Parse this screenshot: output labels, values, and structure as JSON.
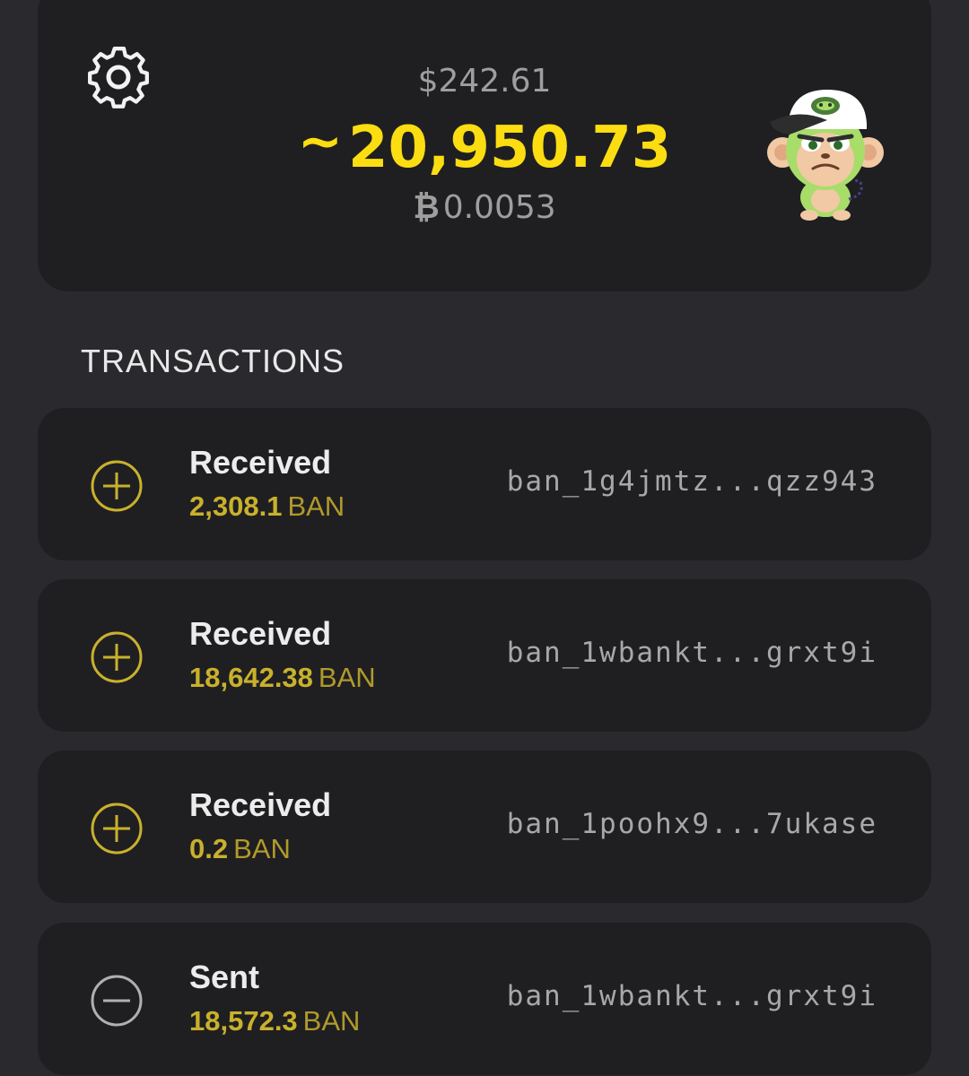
{
  "balance": {
    "fiat": "$242.61",
    "tilde": "~",
    "amount": "20,950.73",
    "btc_symbol": "₿",
    "btc_value": "0.0053"
  },
  "icons": {
    "settings": "gear-icon",
    "avatar": "monkey-avatar",
    "received": "plus-circle-icon",
    "sent": "minus-circle-icon"
  },
  "colors": {
    "accent": "#fbdd11",
    "amount": "#c9b12c",
    "received_icon": "#c9b12c",
    "sent_icon": "#b0b0b0"
  },
  "transactions_section": {
    "title": "TRANSACTIONS"
  },
  "transactions": [
    {
      "type": "Received",
      "amount": "2,308.1",
      "unit": "BAN",
      "address": "ban_1g4jmtz...qzz943",
      "icon": "plus-circle-icon"
    },
    {
      "type": "Received",
      "amount": "18,642.38",
      "unit": "BAN",
      "address": "ban_1wbankt...grxt9i",
      "icon": "plus-circle-icon"
    },
    {
      "type": "Received",
      "amount": "0.2",
      "unit": "BAN",
      "address": "ban_1poohx9...7ukase",
      "icon": "plus-circle-icon"
    },
    {
      "type": "Sent",
      "amount": "18,572.3",
      "unit": "BAN",
      "address": "ban_1wbankt...grxt9i",
      "icon": "minus-circle-icon"
    }
  ]
}
